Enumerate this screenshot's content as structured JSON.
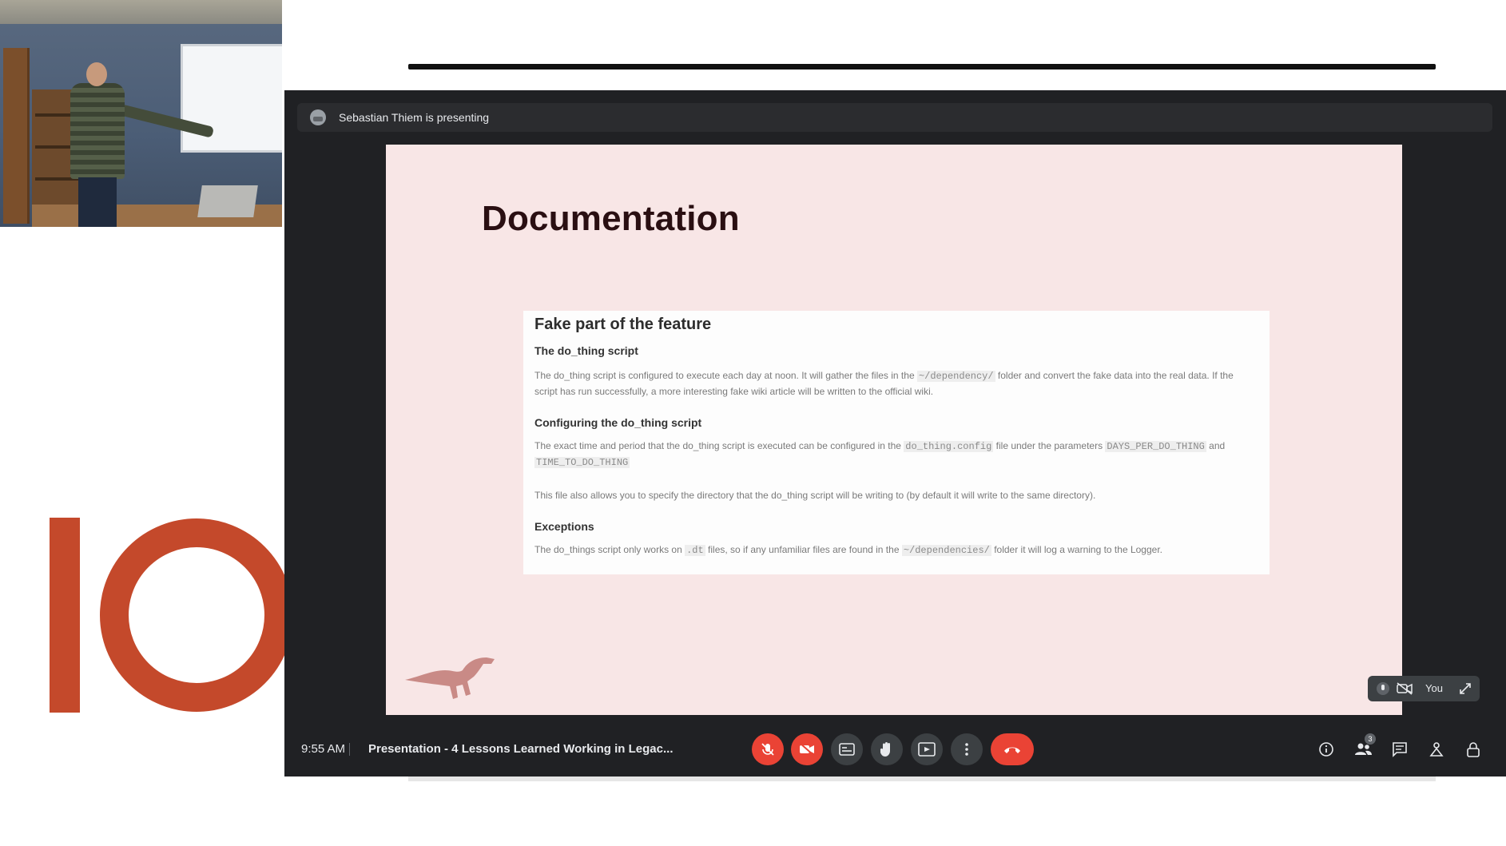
{
  "presenter": {
    "text": "Sebastian Thiem is presenting"
  },
  "slide": {
    "title": "Documentation",
    "card": {
      "heading": "Fake part of the feature",
      "section1_title": "The do_thing script",
      "section1_text_a": "The do_thing script is configured to execute each day at noon. It will gather the files in the ",
      "section1_code": "~/dependency/",
      "section1_text_b": " folder and convert the fake data into the real data. If the script has run successfully, a more interesting fake wiki article will be written to the official wiki.",
      "section2_title": "Configuring the do_thing script",
      "section2_text_a": "The exact time and period that the do_thing script is executed can be configured in the ",
      "section2_code1": "do_thing.config",
      "section2_text_b": " file under the parameters ",
      "section2_code2": "DAYS_PER_DO_THING",
      "section2_text_c": " and ",
      "section2_code3": "TIME_TO_DO_THING",
      "section2_text_d": "",
      "section2_text_e": "This file also allows you to specify the directory that the do_thing script will be writing to (by default it will write to the same directory).",
      "section3_title": "Exceptions",
      "section3_text_a": "The do_things script only works on ",
      "section3_code1": ".dt",
      "section3_text_b": " files, so if any unfamiliar files are found in the ",
      "section3_code2": "~/dependencies/",
      "section3_text_c": " folder it will log a warning to the Logger."
    }
  },
  "self_tile": {
    "label": "You"
  },
  "controls": {
    "time": "9:55 AM",
    "meeting_title": "Presentation - 4 Lessons Learned Working in Legac...",
    "buttons": [
      {
        "name": "mic-off-icon",
        "state": "off"
      },
      {
        "name": "camera-off-icon",
        "state": "off"
      },
      {
        "name": "captions-icon"
      },
      {
        "name": "raise-hand-icon"
      },
      {
        "name": "present-screen-icon"
      },
      {
        "name": "more-options-icon"
      },
      {
        "name": "hang-up-icon"
      }
    ],
    "participants_count": "3"
  },
  "colors": {
    "meet_bg": "#202124",
    "danger": "#ea4335",
    "slide_bg": "#f8e6e6",
    "logo": "#c4492b"
  }
}
